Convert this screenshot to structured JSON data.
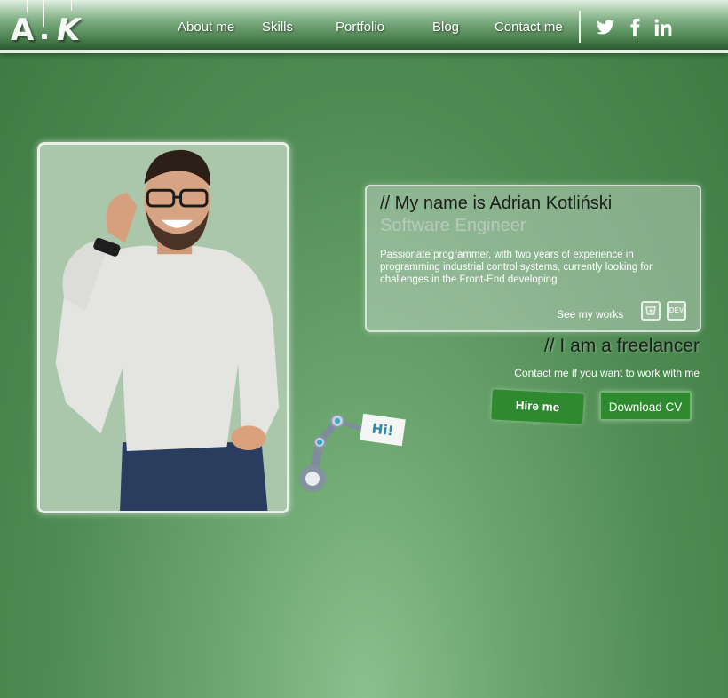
{
  "logo": {
    "text1": "A",
    "text2": "K"
  },
  "nav": {
    "items": [
      {
        "label": "About me"
      },
      {
        "label": "Skills"
      },
      {
        "label": "Portfolio"
      },
      {
        "label": "Blog"
      },
      {
        "label": "Contact me"
      }
    ],
    "social": [
      {
        "icon": "twitter-icon"
      },
      {
        "icon": "facebook-icon"
      },
      {
        "icon": "linkedin-icon"
      }
    ]
  },
  "robot": {
    "sign": "Hi!"
  },
  "card": {
    "title": "// My name is Adrian Kotliński",
    "subtitle": "Software Engineer",
    "description": "Passionate programmer, with two years of experience in programming industrial control systems, currently looking for challenges in the Front-End developing",
    "see_works": "See my works",
    "badges": [
      {
        "icon": "bitbucket-icon",
        "text": ""
      },
      {
        "icon": "dev-icon",
        "text": "DEV"
      }
    ]
  },
  "freelance": {
    "heading": "// I am a freelancer",
    "text": "Contact me if you want to work with me",
    "hire_label": "Hire me",
    "cv_label": "Download CV"
  },
  "colors": {
    "accent_green": "#2d8a2f",
    "background_green": "#4f8c53",
    "subtitle_color": "#b9c9bb"
  }
}
